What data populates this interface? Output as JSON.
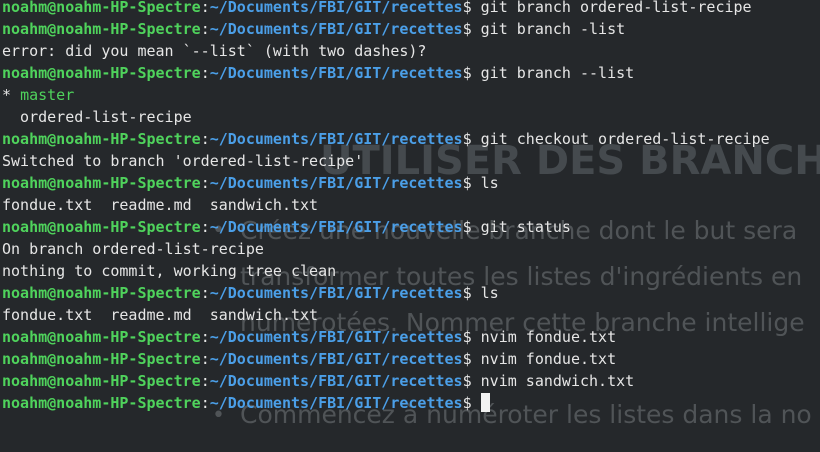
{
  "terminal": {
    "prompt_user": "noahm@noahm-HP-Spectre",
    "prompt_path": "~/Documents/FBI/GIT/recettes",
    "prompt_symbol": "$",
    "lines": [
      {
        "kind": "prompt",
        "command": " git branch ordered-list-recipe"
      },
      {
        "kind": "prompt",
        "command": " git branch -list"
      },
      {
        "kind": "output",
        "text": "error: did you mean `--list` (with two dashes)?"
      },
      {
        "kind": "prompt",
        "command": " git branch --list"
      },
      {
        "kind": "current-branch",
        "marker": "* ",
        "text": "master"
      },
      {
        "kind": "output",
        "text": "  ordered-list-recipe"
      },
      {
        "kind": "prompt",
        "command": " git checkout ordered-list-recipe"
      },
      {
        "kind": "output",
        "text": "Switched to branch 'ordered-list-recipe'"
      },
      {
        "kind": "prompt",
        "command": " ls"
      },
      {
        "kind": "output",
        "text": "fondue.txt  readme.md  sandwich.txt"
      },
      {
        "kind": "prompt",
        "command": " git status"
      },
      {
        "kind": "output",
        "text": "On branch ordered-list-recipe"
      },
      {
        "kind": "output",
        "text": "nothing to commit, working tree clean"
      },
      {
        "kind": "prompt",
        "command": " ls"
      },
      {
        "kind": "output",
        "text": "fondue.txt  readme.md  sandwich.txt"
      },
      {
        "kind": "prompt",
        "command": " nvim fondue.txt"
      },
      {
        "kind": "prompt",
        "command": " nvim fondue.txt"
      },
      {
        "kind": "prompt",
        "command": " nvim sandwich.txt"
      },
      {
        "kind": "prompt-active",
        "command": " "
      }
    ]
  },
  "background_slide": {
    "title": "UTILISER DES BRANCHE",
    "bullet_char": "•",
    "lines": [
      "Créez une nouvelle branche dont le but sera",
      "transformer toutes les listes d'ingrédients en",
      "numérotées. Nommer cette branche intellige",
      "Commencez à numéroter les listes dans la no"
    ]
  }
}
